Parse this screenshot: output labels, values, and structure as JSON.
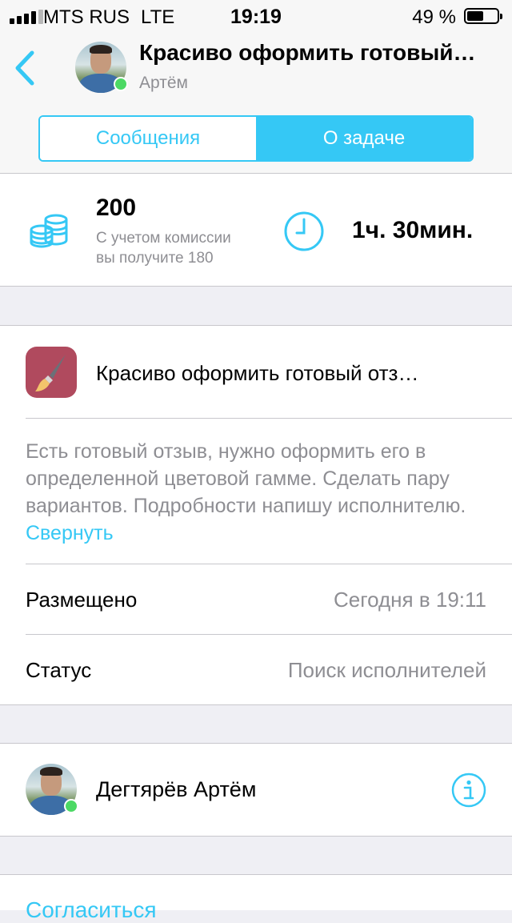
{
  "status_bar": {
    "carrier": "MTS RUS",
    "network": "LTE",
    "time": "19:19",
    "battery_percent": "49 %",
    "battery_level": 0.49,
    "signal_bars": 4
  },
  "header": {
    "back_icon": "chevron-left-icon",
    "title": "Красиво оформить готовый…",
    "subtitle": "Артём",
    "tabs": [
      {
        "label": "Сообщения",
        "active": false
      },
      {
        "label": "О задаче",
        "active": true
      }
    ]
  },
  "payment": {
    "icon": "coins-icon",
    "price": "200",
    "commission_line1": "С учетом комиссии",
    "commission_line2": "вы получите 180",
    "clock_icon": "clock-icon",
    "duration": "1ч. 30мин."
  },
  "task": {
    "icon": "paintbrush-icon",
    "title": "Красиво оформить готовый отз…",
    "description": "Есть готовый отзыв, нужно оформить его в определенной цветовой гамме. Сделать пару вариантов. Подробности напишу исполнителю.",
    "collapse_label": "Свернуть",
    "rows": [
      {
        "label": "Размещено",
        "value": "Сегодня в 19:11"
      },
      {
        "label": "Статус",
        "value": "Поиск исполнителей"
      }
    ]
  },
  "author": {
    "name": "Дегтярёв Артём",
    "info_icon": "info-icon"
  },
  "actions": {
    "agree_label": "Согласиться"
  },
  "colors": {
    "accent": "#35c8f5",
    "online": "#4cd964",
    "app_icon": "#b04a5e",
    "secondary_text": "#8e8e93"
  }
}
